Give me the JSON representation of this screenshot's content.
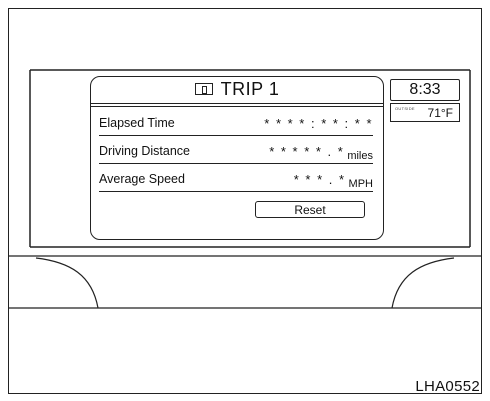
{
  "screen": {
    "title": "TRIP 1",
    "rows": [
      {
        "label": "Elapsed Time",
        "value": "* * * * : * * : * *",
        "unit": ""
      },
      {
        "label": "Driving Distance",
        "value": "* * * * * . *",
        "unit": "miles"
      },
      {
        "label": "Average Speed",
        "value": "* * * . *",
        "unit": "MPH"
      }
    ],
    "reset_label": "Reset"
  },
  "clock": {
    "time": "8:33"
  },
  "temperature": {
    "outside_label": "OUTSIDE",
    "value": "71°F"
  },
  "caption": "LHA0552",
  "icons": {
    "trip": "trip-odometer-icon"
  }
}
